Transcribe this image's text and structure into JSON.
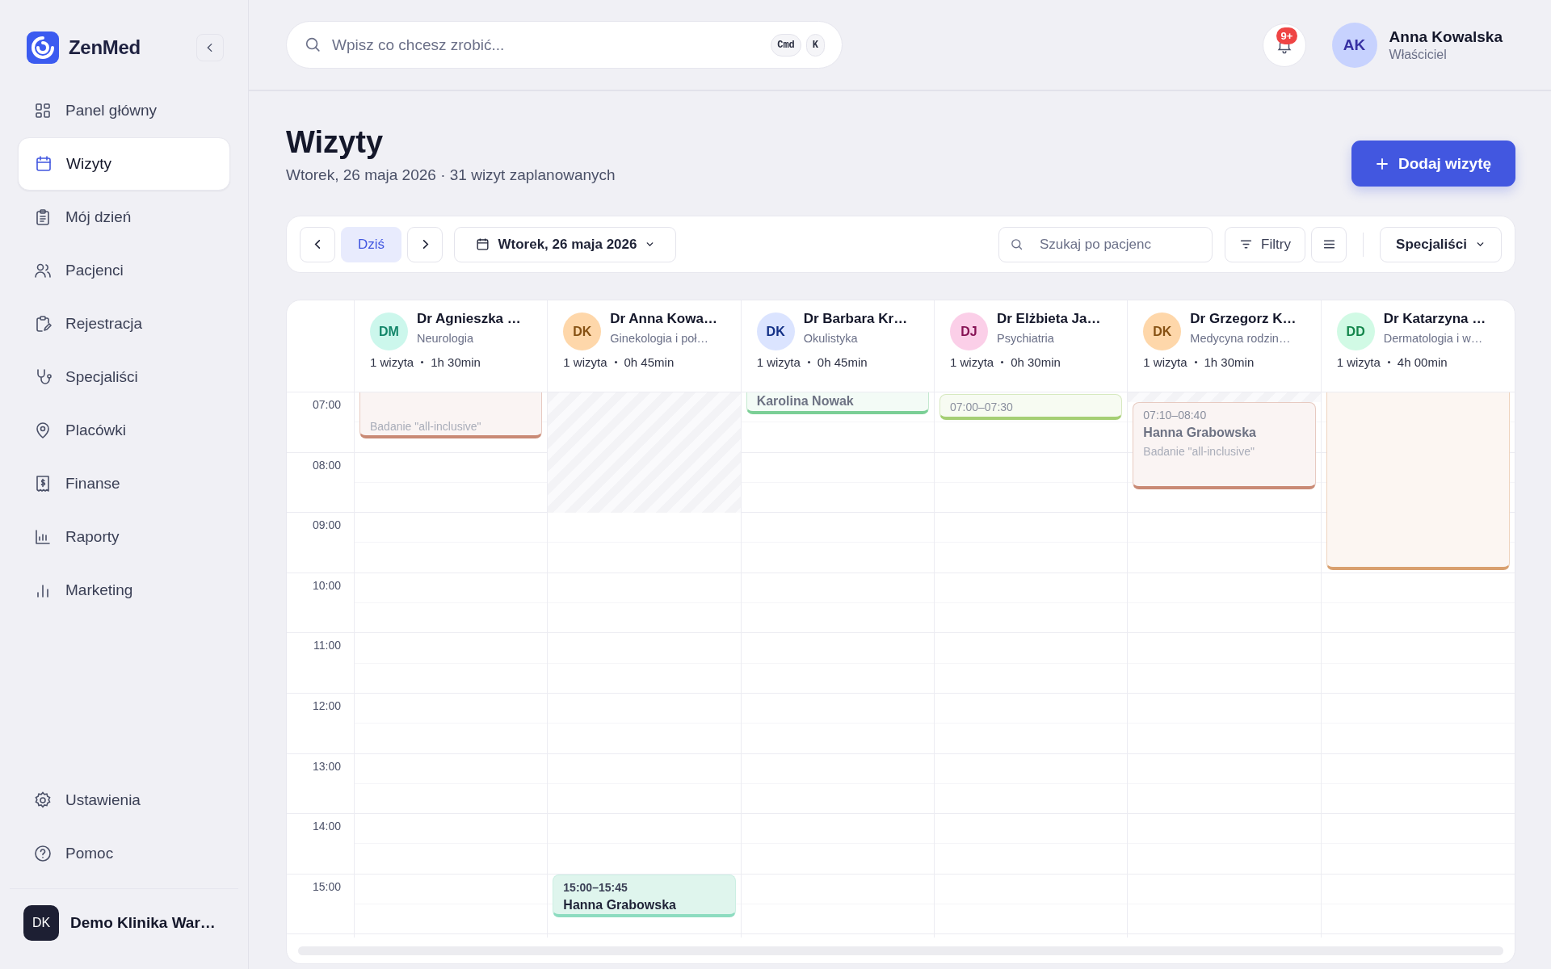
{
  "sidebar": {
    "logo": "ZenMed",
    "items": [
      {
        "label": "Panel główny",
        "selected": false
      },
      {
        "label": "Wizyty",
        "selected": true
      },
      {
        "label": "Mój dzień",
        "selected": false
      },
      {
        "label": "Pacjenci",
        "selected": false
      },
      {
        "label": "Rejestracja",
        "selected": false
      },
      {
        "label": "Specjaliści",
        "selected": false
      },
      {
        "label": "Placówki",
        "selected": false
      },
      {
        "label": "Finanse",
        "selected": false
      },
      {
        "label": "Raporty",
        "selected": false
      },
      {
        "label": "Marketing",
        "selected": false
      }
    ],
    "bottom_items": [
      {
        "label": "Ustawienia",
        "selected": false
      },
      {
        "label": "Pomoc",
        "selected": false
      }
    ],
    "clinic": {
      "initials": "DK",
      "name": "Demo Klinika War…"
    }
  },
  "topbar": {
    "search": {
      "placeholder": "Wpisz co chcesz zrobić...",
      "keys": [
        "Cmd",
        "K"
      ]
    },
    "notifications": {
      "badge": "9+"
    },
    "user": {
      "initials": "AK",
      "name": "Anna Kowalska",
      "role": "Właściciel"
    }
  },
  "header": {
    "title": "Wizyty",
    "subtitle": "Wtorek, 26 maja 2026 · 31 wizyt zaplanowanych",
    "add_button": "Dodaj wizytę"
  },
  "toolbar": {
    "today": {
      "label": "Dziś",
      "selected": true
    },
    "date": "Wtorek, 26 maja 2026",
    "search": {
      "placeholder": "Szukaj po pacjenc"
    },
    "filters": "Filtry",
    "view_select": "Specjaliści"
  },
  "calendar": {
    "hours": [
      "07:00",
      "08:00",
      "09:00",
      "10:00",
      "11:00",
      "12:00",
      "13:00",
      "14:00",
      "15:00"
    ],
    "columns": [
      {
        "initials": "DM",
        "color": "#ccf7ec",
        "name": "Dr Agnieszka …",
        "specialty": "Neurologia",
        "visits": "1 wizyta",
        "duration": "1h 30min",
        "events": [
          {
            "service": "Badanie \"all-inclusive\"",
            "color": "#c98a75",
            "past": true
          }
        ]
      },
      {
        "initials": "DK",
        "color": "#fed7aa",
        "name": "Dr Anna Kowa…",
        "specialty": "Ginekologia i poł…",
        "visits": "1 wizyta",
        "duration": "0h 45min",
        "events": [
          {
            "time": "15:00–15:45",
            "patient": "Hanna Grabowska",
            "color": "#8ddcc0",
            "past": false
          }
        ]
      },
      {
        "initials": "DK",
        "color": "#dbe4ff",
        "name": "Dr Barbara Kr…",
        "specialty": "Okulistyka",
        "visits": "1 wizyta",
        "duration": "0h 45min",
        "events": [
          {
            "patient": "Karolina Nowak",
            "color": "#7bcf96",
            "past": true
          }
        ]
      },
      {
        "initials": "DJ",
        "color": "#fbcfe8",
        "name": "Dr Elżbieta Ja…",
        "specialty": "Psychiatria",
        "visits": "1 wizyta",
        "duration": "0h 30min",
        "events": [
          {
            "time": "07:00–07:30",
            "color": "#a5cf74",
            "past": true
          }
        ]
      },
      {
        "initials": "DK",
        "color": "#fed7aa",
        "name": "Dr Grzegorz K…",
        "specialty": "Medycyna rodzin…",
        "visits": "1 wizyta",
        "duration": "1h 30min",
        "events": [
          {
            "time": "07:10–08:40",
            "patient": "Hanna Grabowska",
            "service": "Badanie \"all-inclusive\"",
            "color": "#c98a75",
            "past": true
          }
        ]
      },
      {
        "initials": "DD",
        "color": "#d1fae5",
        "name": "Dr Katarzyna …",
        "specialty": "Dermatologia i w…",
        "visits": "1 wizyta",
        "duration": "4h 00min",
        "events": [
          {
            "color": "#d9a06f",
            "past": true
          }
        ]
      }
    ]
  }
}
